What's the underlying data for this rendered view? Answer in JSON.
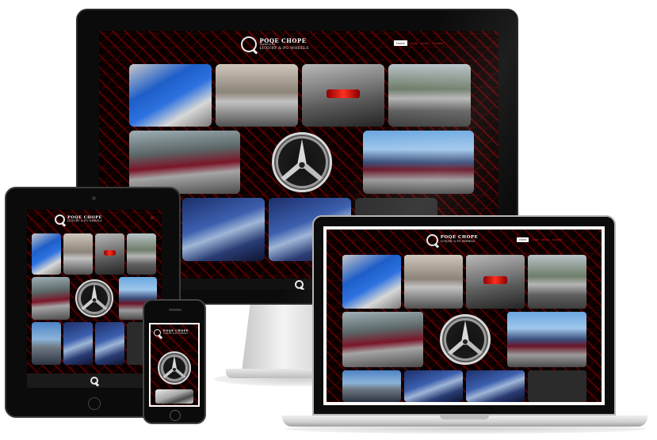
{
  "site": {
    "brand_title": "POQE CHOPE",
    "brand_tagline": "EXPERTS AT",
    "brand_subtitle": "LUXURY & PG WHEELS",
    "logo_letter": "Q",
    "nav": [
      "Home",
      "Shop",
      "About",
      "Contact"
    ],
    "active_nav": "Home",
    "menu_icon": "≡"
  },
  "devices": [
    "desktop-monitor",
    "tablet",
    "laptop",
    "smartphone"
  ],
  "icons": [
    "hamburger-menu-icon",
    "wheel-emblem-icon",
    "q-logo-icon"
  ],
  "colors": {
    "accent_red": "#cc2020",
    "pattern_red": "#aa0000",
    "screen_black": "#0a0000",
    "bezel": "#0b0b0b"
  }
}
